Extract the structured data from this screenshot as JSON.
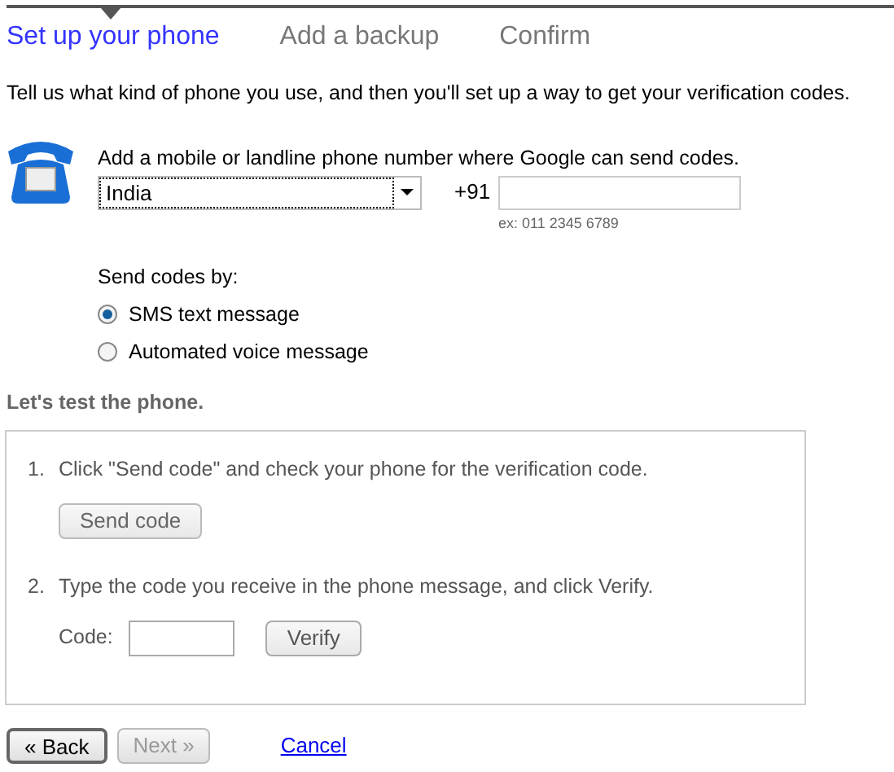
{
  "steps": [
    {
      "label": "Set up your phone",
      "selected": true
    },
    {
      "label": "Add a backup",
      "selected": false
    },
    {
      "label": "Confirm",
      "selected": false
    }
  ],
  "intro": "Tell us what kind of phone you use, and then you'll set up a way to get your verification codes.",
  "phone": {
    "label": "Add a mobile or landline phone number where Google can send codes.",
    "country": "India",
    "prefix": "+91",
    "hint": "ex: 011 2345 6789"
  },
  "send_by": {
    "label": "Send codes by:",
    "options": [
      {
        "label": "SMS text message",
        "selected": true
      },
      {
        "label": "Automated voice message",
        "selected": false
      }
    ]
  },
  "test": {
    "heading": "Let's test the phone.",
    "steps": [
      {
        "number": "1.",
        "text": "Click \"Send code\" and check your phone for the verification code.",
        "kind": "button",
        "button": "Send code"
      },
      {
        "number": "2.",
        "text": "Type the code you receive in the phone message, and click Verify.",
        "kind": "code",
        "field_label": "Code:",
        "button": "Verify"
      }
    ]
  },
  "footer": {
    "buttons": [
      {
        "label": "« Back",
        "disabled": false
      },
      {
        "label": "Next »",
        "disabled": true
      }
    ],
    "cancel": "Cancel"
  }
}
